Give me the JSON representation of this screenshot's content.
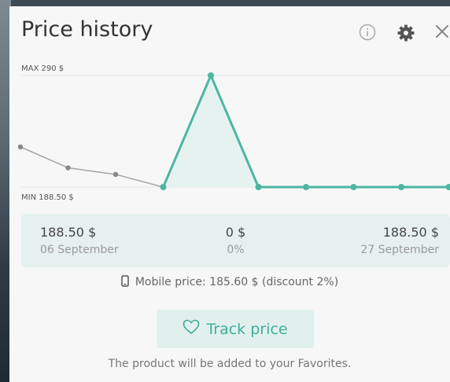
{
  "window": {
    "title": "Price history"
  },
  "header_icons": [
    "info-icon",
    "gear-icon",
    "close-icon"
  ],
  "chart_data": {
    "type": "line",
    "max_label": "MAX 290 $",
    "min_label": "MIN 188.50 $",
    "ylim": [
      188.5,
      290
    ],
    "x": [
      0,
      1,
      2,
      3,
      4,
      5,
      6,
      7,
      8,
      9
    ],
    "series": [
      {
        "values": [
          225,
          206,
          200,
          188.5,
          290,
          188.5,
          188.5,
          188.5,
          188.5,
          188.5
        ]
      }
    ],
    "colors": {
      "past": "#a8a8a8",
      "current": "#4db6a1",
      "area": "#e6f2f0"
    }
  },
  "summary": {
    "start_price": "188.50 $",
    "start_date": "06 September",
    "change_value": "0 $",
    "change_percent": "0%",
    "end_price": "188.50 $",
    "end_date": "27 September"
  },
  "mobile_price_text": "Mobile price: 185.60 $ (discount 2%)",
  "track_button_label": "Track price",
  "favorites_note": "The product will be added to your Favorites."
}
